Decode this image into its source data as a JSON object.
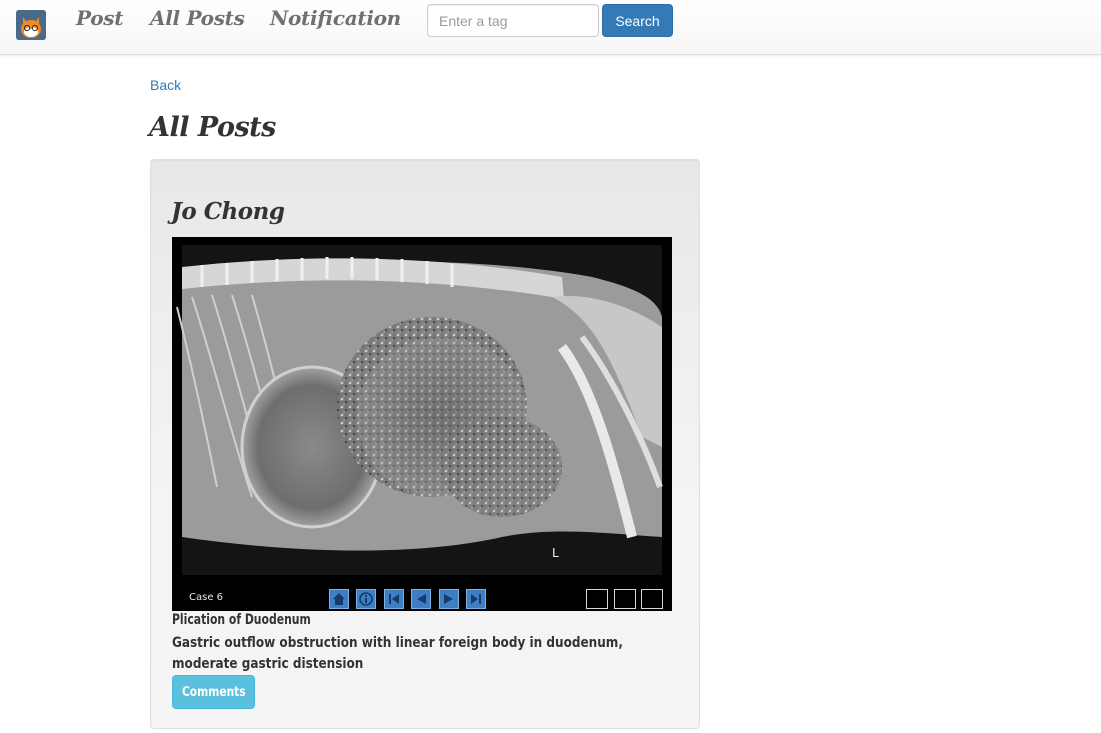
{
  "navbar": {
    "logo": "cat-logo-icon",
    "links": [
      "Post",
      "All Posts",
      "Notification"
    ],
    "search": {
      "placeholder": "Enter a tag",
      "value": "",
      "button_label": "Search"
    }
  },
  "back_label": "Back",
  "page_title": "All Posts",
  "post": {
    "author": "Jo Chong",
    "image_viewer": {
      "case_label": "Case 6",
      "marker": "L",
      "controls": [
        "home-icon",
        "info-icon",
        "first-icon",
        "prev-icon",
        "next-icon",
        "last-icon"
      ],
      "view_boxes": 3
    },
    "title": "Plication of Duodenum",
    "description": "Gastric outflow obstruction with linear foreign body in duodenum, moderate gastric distension",
    "comments_label": "Comments"
  },
  "colors": {
    "primary": "#337ab7",
    "info": "#5bc0de",
    "link": "#337ab7",
    "card_bg": "#f0f0f0",
    "nav_text": "#707070"
  }
}
